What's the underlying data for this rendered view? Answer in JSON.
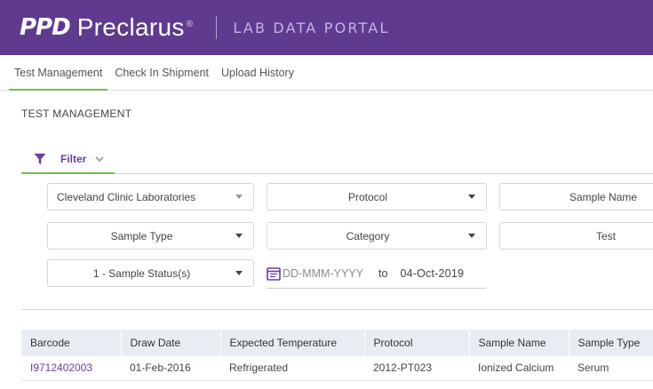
{
  "header": {
    "logo_ppd": "PPD",
    "logo_name": "Preclarus",
    "logo_reg": "®",
    "portal_title": "LAB DATA PORTAL"
  },
  "nav": {
    "tabs": [
      {
        "label": "Test Management",
        "active": true
      },
      {
        "label": "Check In Shipment",
        "active": false
      },
      {
        "label": "Upload History",
        "active": false
      }
    ]
  },
  "page": {
    "section_title": "TEST MANAGEMENT"
  },
  "filter": {
    "label": "Filter",
    "dropdowns": {
      "lab": "Cleveland Clinic Laboratories",
      "protocol": "Protocol",
      "sample_name": "Sample Name",
      "sample_type": "Sample Type",
      "category": "Category",
      "test": "Test",
      "status": "1 - Sample Status(s)"
    },
    "date_from_placeholder": "DD-MMM-YYYY",
    "date_to_label": "to",
    "date_to_value": "04-Oct-2019"
  },
  "table": {
    "columns": [
      "Barcode",
      "Draw Date",
      "Expected Temperature",
      "Protocol",
      "Sample Name",
      "Sample Type"
    ],
    "rows": [
      [
        "I9712402003",
        "01-Feb-2016",
        "Refrigerated",
        "2012-PT023",
        "Ionized Calcium",
        "Serum"
      ]
    ]
  },
  "colors": {
    "header_bg": "#5f3a8f",
    "accent_green": "#6fbf4a",
    "accent_purple": "#6a3f9b",
    "table_header_bg": "#e8edf3"
  },
  "icons": {
    "filter": "funnel-icon",
    "chevron": "chevron-down-icon",
    "dropdown": "caret-down-icon",
    "calendar": "calendar-icon"
  }
}
